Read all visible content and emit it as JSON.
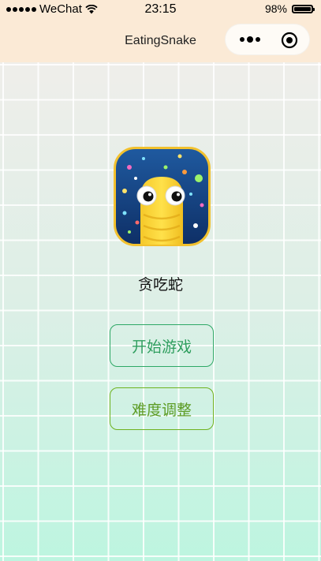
{
  "status_bar": {
    "carrier": "WeChat",
    "time": "23:15",
    "battery_percent_label": "98%",
    "battery_level": 0.98
  },
  "nav_bar": {
    "title": "EatingSnake",
    "background": "#fbead6"
  },
  "app": {
    "name": "贪吃蛇",
    "icon": "snake-game-icon"
  },
  "buttons": {
    "start": "开始游戏",
    "difficulty": "难度调整"
  },
  "colors": {
    "start_button": "#2ea866",
    "difficulty_button": "#6eb21e",
    "background_top": "#efeeea",
    "background_bottom": "#bdf5e0"
  }
}
